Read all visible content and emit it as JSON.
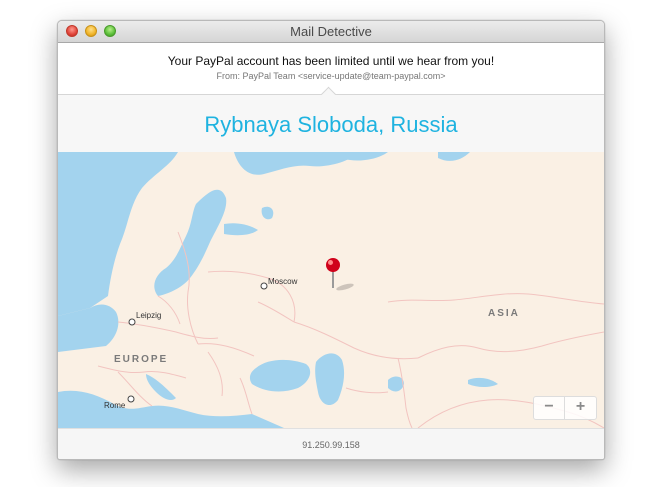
{
  "window": {
    "title": "Mail Detective"
  },
  "email": {
    "subject": "Your PayPal account has been limited until we hear from you!",
    "from": "From: PayPal Team <service-update@team-paypal.com>"
  },
  "location": {
    "name": "Rybnaya Sloboda, Russia"
  },
  "map": {
    "cities": [
      "Moscow",
      "Leipzig",
      "Rome"
    ],
    "regions": [
      "EUROPE",
      "ASIA"
    ],
    "zoom_out_label": "−",
    "zoom_in_label": "+",
    "colors": {
      "water": "#a3d3ee",
      "land": "#faf0e4",
      "borders": "#f2c4c0",
      "pin": "#d0021b"
    }
  },
  "footer": {
    "ip": "91.250.99.158"
  }
}
